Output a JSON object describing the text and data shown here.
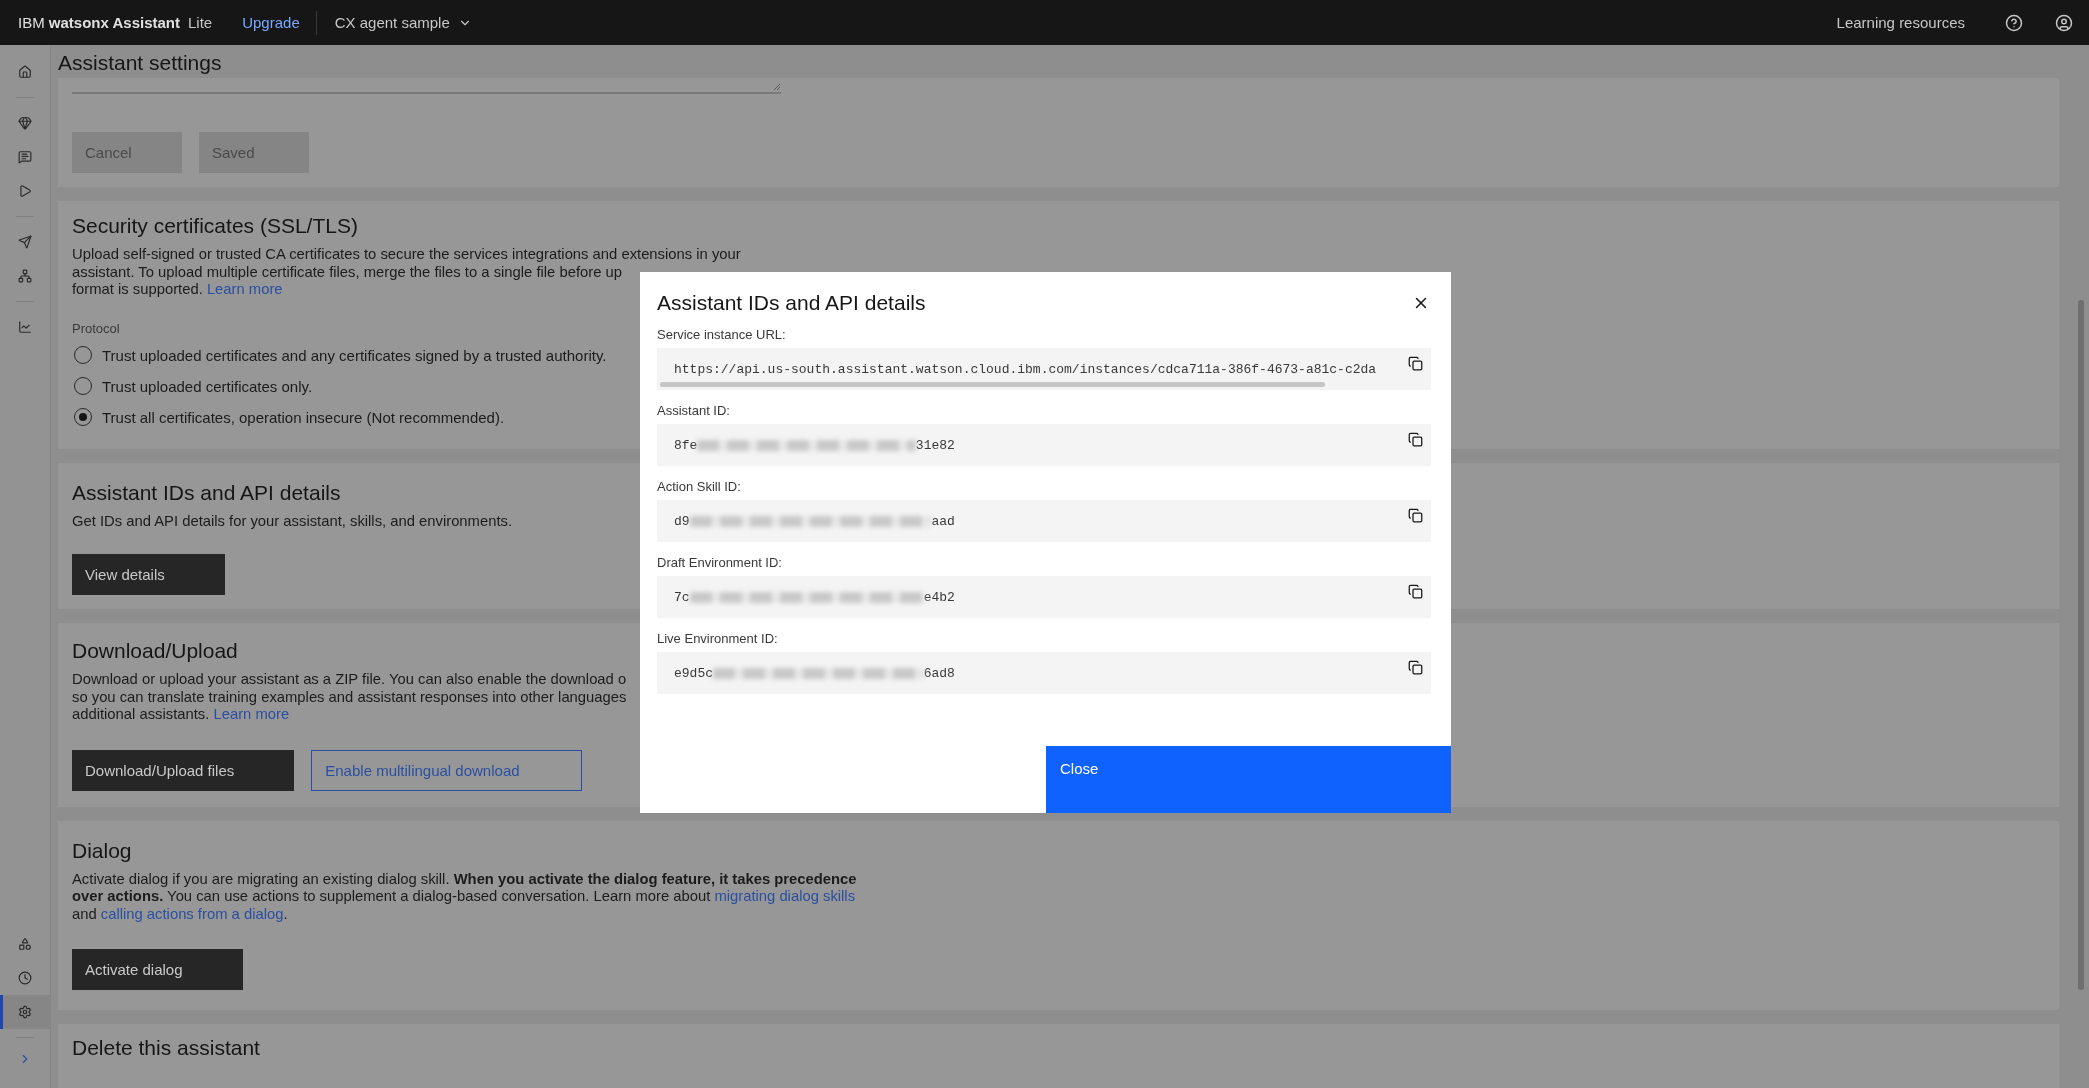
{
  "top_bar": {
    "brand": "IBM **watsonx Assistant**",
    "plan": "Lite",
    "upgrade_link": "Upgrade",
    "assistant_selector": "CX agent sample",
    "learning_resources": "Learning resources"
  },
  "sidebar": {
    "top_groups": [
      [
        {
          "selected": false
        }
      ],
      [
        {
          "selected": false
        },
        {
          "selected": false
        },
        {
          "selected": false
        }
      ],
      [
        {
          "selected": false
        },
        {
          "selected": false
        }
      ],
      [
        {
          "selected": false
        }
      ]
    ],
    "bottom_items": [
      {
        "selected": false
      },
      {
        "selected": false
      },
      {
        "selected": true
      }
    ]
  },
  "page": {
    "title": "Assistant settings"
  },
  "sections": [
    {
      "kind": "form_actions",
      "buttons": [
        {
          "label": "Cancel",
          "kind": "secondary",
          "disabled": true
        },
        {
          "label": "Saved",
          "kind": "secondary",
          "disabled": true
        }
      ]
    },
    {
      "kind": "certificates",
      "title": "Security certificates (SSL/TLS)",
      "description_lines": [
        [
          {
            "kind": "text",
            "text": "Upload self-signed or trusted CA certificates to secure the services integrations and extensions in your"
          }
        ],
        [
          {
            "kind": "text",
            "text": "assistant. To upload multiple certificate files, merge the files to a single file before up"
          }
        ],
        [
          {
            "kind": "text",
            "text": "format is supported. "
          },
          {
            "kind": "link",
            "text": "Learn more"
          }
        ]
      ],
      "protocol_label": "Protocol",
      "options": [
        {
          "label": "Trust uploaded certificates and any certificates signed by a trusted authority.",
          "selected": false
        },
        {
          "label": "Trust uploaded certificates only.",
          "selected": false
        },
        {
          "label": "Trust all certificates, operation insecure (Not recommended).",
          "selected": true
        }
      ]
    },
    {
      "kind": "ids",
      "title": "Assistant IDs and API details",
      "description_lines": [
        [
          {
            "kind": "text",
            "text": "Get IDs and API details for your assistant, skills, and environments."
          }
        ]
      ],
      "buttons": [
        {
          "label": "View details",
          "kind": "primary",
          "disabled": false
        }
      ]
    },
    {
      "kind": "download",
      "title": "Download/Upload",
      "description_lines": [
        [
          {
            "kind": "text",
            "text": "Download or upload your assistant as a ZIP file. You can also enable the download o"
          }
        ],
        [
          {
            "kind": "text",
            "text": "so you can translate training examples and assistant responses into other languages"
          }
        ],
        [
          {
            "kind": "text",
            "text": "additional assistants. "
          },
          {
            "kind": "link",
            "text": "Learn more"
          }
        ]
      ],
      "buttons": [
        {
          "label": "Download/Upload files",
          "kind": "primary",
          "disabled": false
        },
        {
          "label": "Enable multilingual download",
          "kind": "tertiary",
          "disabled": false
        }
      ]
    },
    {
      "kind": "dialog",
      "title": "Dialog",
      "description": [
        {
          "kind": "text",
          "text": "Activate dialog if you are migrating an existing dialog skill. **When you activate the dialog feature, it takes precedence over actions.** You can use actions to supplement a dialog-based conversation. Learn more about "
        },
        {
          "kind": "link",
          "text": "migrating dialog skills"
        },
        {
          "kind": "text",
          "text": " and "
        },
        {
          "kind": "link",
          "text": "calling actions from a dialog"
        },
        {
          "kind": "text",
          "text": "."
        }
      ],
      "buttons": [
        {
          "label": "Activate dialog",
          "kind": "primary",
          "disabled": false
        }
      ]
    },
    {
      "kind": "delete",
      "title": "Delete this assistant"
    }
  ],
  "modal": {
    "title": "Assistant IDs and API details",
    "fields": [
      {
        "label": "Service instance URL:",
        "kind": "url",
        "value": "https://api.us-south.assistant.watson.cloud.ibm.com/instances/cdca711a-386f-4673-a81c-c2da"
      },
      {
        "label": "Assistant ID:",
        "kind": "redacted",
        "prefix": "8fe",
        "suffix": "31e82"
      },
      {
        "label": "Action Skill ID:",
        "kind": "redacted",
        "prefix": "d9",
        "suffix": "aad"
      },
      {
        "label": "Draft Environment ID:",
        "kind": "redacted",
        "prefix": "7c",
        "suffix": "e4b2"
      },
      {
        "label": "Live Environment ID:",
        "kind": "redacted",
        "prefix": "e9d5c",
        "suffix": "6ad8"
      }
    ],
    "close_button": "Close"
  }
}
